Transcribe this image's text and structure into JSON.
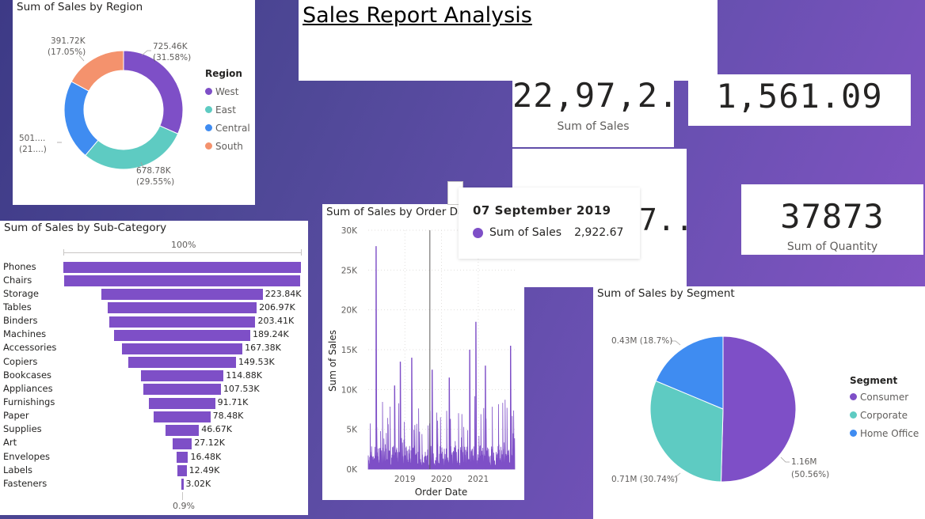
{
  "report_title": "Sales Report Analysis",
  "colors": {
    "purple": "#7e4fc7",
    "teal": "#5ecbc2",
    "blue": "#3f8cf1",
    "salmon": "#f4926d",
    "funnel_bar": "#7e4fc7"
  },
  "region_chart": {
    "title": "Sum of Sales by Region",
    "legend_title": "Region",
    "legend": [
      "West",
      "East",
      "Central",
      "South"
    ],
    "labels": {
      "west": [
        "725.46K",
        "(31.58%)"
      ],
      "east": [
        "678.78K",
        "(29.55%)"
      ],
      "central": [
        "501....",
        "(21....)"
      ],
      "south": [
        "391.72K",
        "(17.05%)"
      ]
    }
  },
  "kpis": {
    "sales_value": "22,97,2...",
    "sales_caption": "Sum of Sales",
    "profit_value": "1,561.09",
    "hidden_value": "7...",
    "quantity_value": "37873",
    "quantity_caption": "Sum of Quantity"
  },
  "subcategory_chart": {
    "title": "Sum of Sales by Sub-Category",
    "top_pct": "100%",
    "bottom_pct": "0.9%"
  },
  "order_date_chart": {
    "title": "Sum of Sales by Order Date",
    "xlabel": "Order Date",
    "ylabel": "Sum of Sales",
    "yticks": [
      "30K",
      "25K",
      "20K",
      "15K",
      "10K",
      "5K",
      "0K"
    ],
    "xticks": [
      "2019",
      "2020",
      "2021"
    ]
  },
  "tooltip": {
    "date": "07 September 2019",
    "series": "Sum of Sales",
    "value": "2,922.67"
  },
  "segment_chart": {
    "title": "Sum of Sales by Segment",
    "legend_title": "Segment",
    "legend": [
      "Consumer",
      "Corporate",
      "Home Office"
    ],
    "labels": {
      "consumer": [
        "1.16M",
        "(50.56%)"
      ],
      "corporate": [
        "0.71M (30.74%)"
      ],
      "home_office": [
        "0.43M (18.7%)"
      ]
    }
  },
  "chart_data": [
    {
      "type": "pie",
      "title": "Sum of Sales by Region",
      "categories": [
        "West",
        "East",
        "Central",
        "South"
      ],
      "values": [
        725.46,
        678.78,
        501.24,
        391.72
      ],
      "percent": [
        31.58,
        29.55,
        21.82,
        17.05
      ],
      "unit": "K",
      "donut": true
    },
    {
      "type": "bar",
      "title": "Sum of Sales by Sub-Category",
      "categories": [
        "Phones",
        "Chairs",
        "Storage",
        "Tables",
        "Binders",
        "Machines",
        "Accessories",
        "Copiers",
        "Bookcases",
        "Appliances",
        "Furnishings",
        "Paper",
        "Supplies",
        "Art",
        "Envelopes",
        "Labels",
        "Fasteners"
      ],
      "values": [
        330.0,
        328.5,
        223.84,
        206.97,
        203.41,
        189.24,
        167.38,
        149.53,
        114.88,
        107.53,
        91.71,
        78.48,
        46.67,
        27.12,
        16.48,
        12.49,
        3.02
      ],
      "value_labels": [
        "",
        "",
        "223.84K",
        "206.97K",
        "203.41K",
        "189.24K",
        "167.38K",
        "149.53K",
        "114.88K",
        "107.53K",
        "91.71K",
        "78.48K",
        "46.67K",
        "27.12K",
        "16.48K",
        "12.49K",
        "3.02K"
      ],
      "unit": "K",
      "style": "funnel"
    },
    {
      "type": "line",
      "title": "Sum of Sales by Order Date",
      "xlabel": "Order Date",
      "ylabel": "Sum of Sales",
      "ylim": [
        0,
        30000
      ],
      "xlim": [
        "2018-01-01",
        "2021-12-31"
      ],
      "highlight": {
        "x": "2019-09-07",
        "y": 2922.67
      },
      "peaks": [
        {
          "x": "2018-03-18",
          "y": 28000
        },
        {
          "x": "2018-09-20",
          "y": 10500
        },
        {
          "x": "2018-11-15",
          "y": 13500
        },
        {
          "x": "2019-03-10",
          "y": 14000
        },
        {
          "x": "2019-10-01",
          "y": 12500
        },
        {
          "x": "2020-03-20",
          "y": 11500
        },
        {
          "x": "2020-10-10",
          "y": 15000
        },
        {
          "x": "2020-12-10",
          "y": 18500
        },
        {
          "x": "2021-03-15",
          "y": 13000
        },
        {
          "x": "2021-11-20",
          "y": 15500
        }
      ]
    },
    {
      "type": "pie",
      "title": "Sum of Sales by Segment",
      "categories": [
        "Consumer",
        "Corporate",
        "Home Office"
      ],
      "values": [
        1.16,
        0.71,
        0.43
      ],
      "percent": [
        50.56,
        30.74,
        18.7
      ],
      "unit": "M"
    }
  ]
}
